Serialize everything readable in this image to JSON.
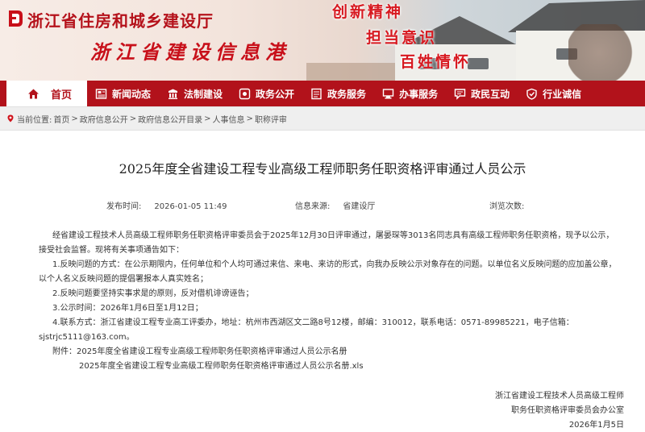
{
  "header": {
    "site_title": "浙江省住房和城乡建设厅",
    "site_subtitle": "浙江省建设信息港",
    "slogans": [
      "创新精神",
      "担当意识",
      "百姓情怀"
    ],
    "brand_color": "#b2121b"
  },
  "nav": {
    "items": [
      {
        "label": "首页",
        "icon": "home-icon"
      },
      {
        "label": "新闻动态",
        "icon": "newspaper-icon"
      },
      {
        "label": "法制建设",
        "icon": "law-icon"
      },
      {
        "label": "政务公开",
        "icon": "disclosure-icon"
      },
      {
        "label": "政务服务",
        "icon": "service-icon"
      },
      {
        "label": "办事服务",
        "icon": "handling-icon"
      },
      {
        "label": "政民互动",
        "icon": "interaction-icon"
      },
      {
        "label": "行业诚信",
        "icon": "credit-icon"
      }
    ]
  },
  "breadcrumb": {
    "prefix": "当前位置:",
    "items": [
      "首页",
      "政府信息公开",
      "政府信息公开目录",
      "人事信息",
      "职称评审"
    ],
    "separator": ">"
  },
  "article": {
    "title": "2025年度全省建设工程专业高级工程师职务任职资格评审通过人员公示",
    "publish_label": "发布时间:",
    "publish_time": "2026-01-05 11:49",
    "source_label": "信息来源:",
    "source": "省建设厅",
    "views_label": "浏览次数:",
    "paragraphs": [
      "经省建设工程技术人员高级工程师职务任职资格评审委员会于2025年12月30日评审通过，屠晏琛等3013名同志具有高级工程师职务任职资格，现予以公示，",
      "接受社会监督。现将有关事项通告如下：",
      "1.反映问题的方式：在公示期限内，任何单位和个人均可通过来信、来电、来访的形式，向我办反映公示对象存在的问题。以单位名义反映问题的应加盖公章，",
      "以个人名义反映问题的提倡署报本人真实姓名；",
      "2.反映问题要坚持实事求是的原则，反对借机诽谤诬告；",
      "3.公示时间：2026年1月6日至1月12日；",
      "4.联系方式：浙江省建设工程专业高工评委办，地址：杭州市西湖区文二路8号12楼，邮编：310012，联系电话：0571-89985221，电子信箱：",
      "sjstrjc5111@163.com。",
      "附件：2025年度全省建设工程专业高级工程师职务任职资格评审通过人员公示名册",
      "2025年度全省建设工程专业高级工程师职务任职资格评审通过人员公示名册.xls"
    ],
    "signature": [
      "浙江省建设工程技术人员高级工程师",
      "职务任职资格评审委员会办公室",
      "2026年1月5日"
    ]
  }
}
